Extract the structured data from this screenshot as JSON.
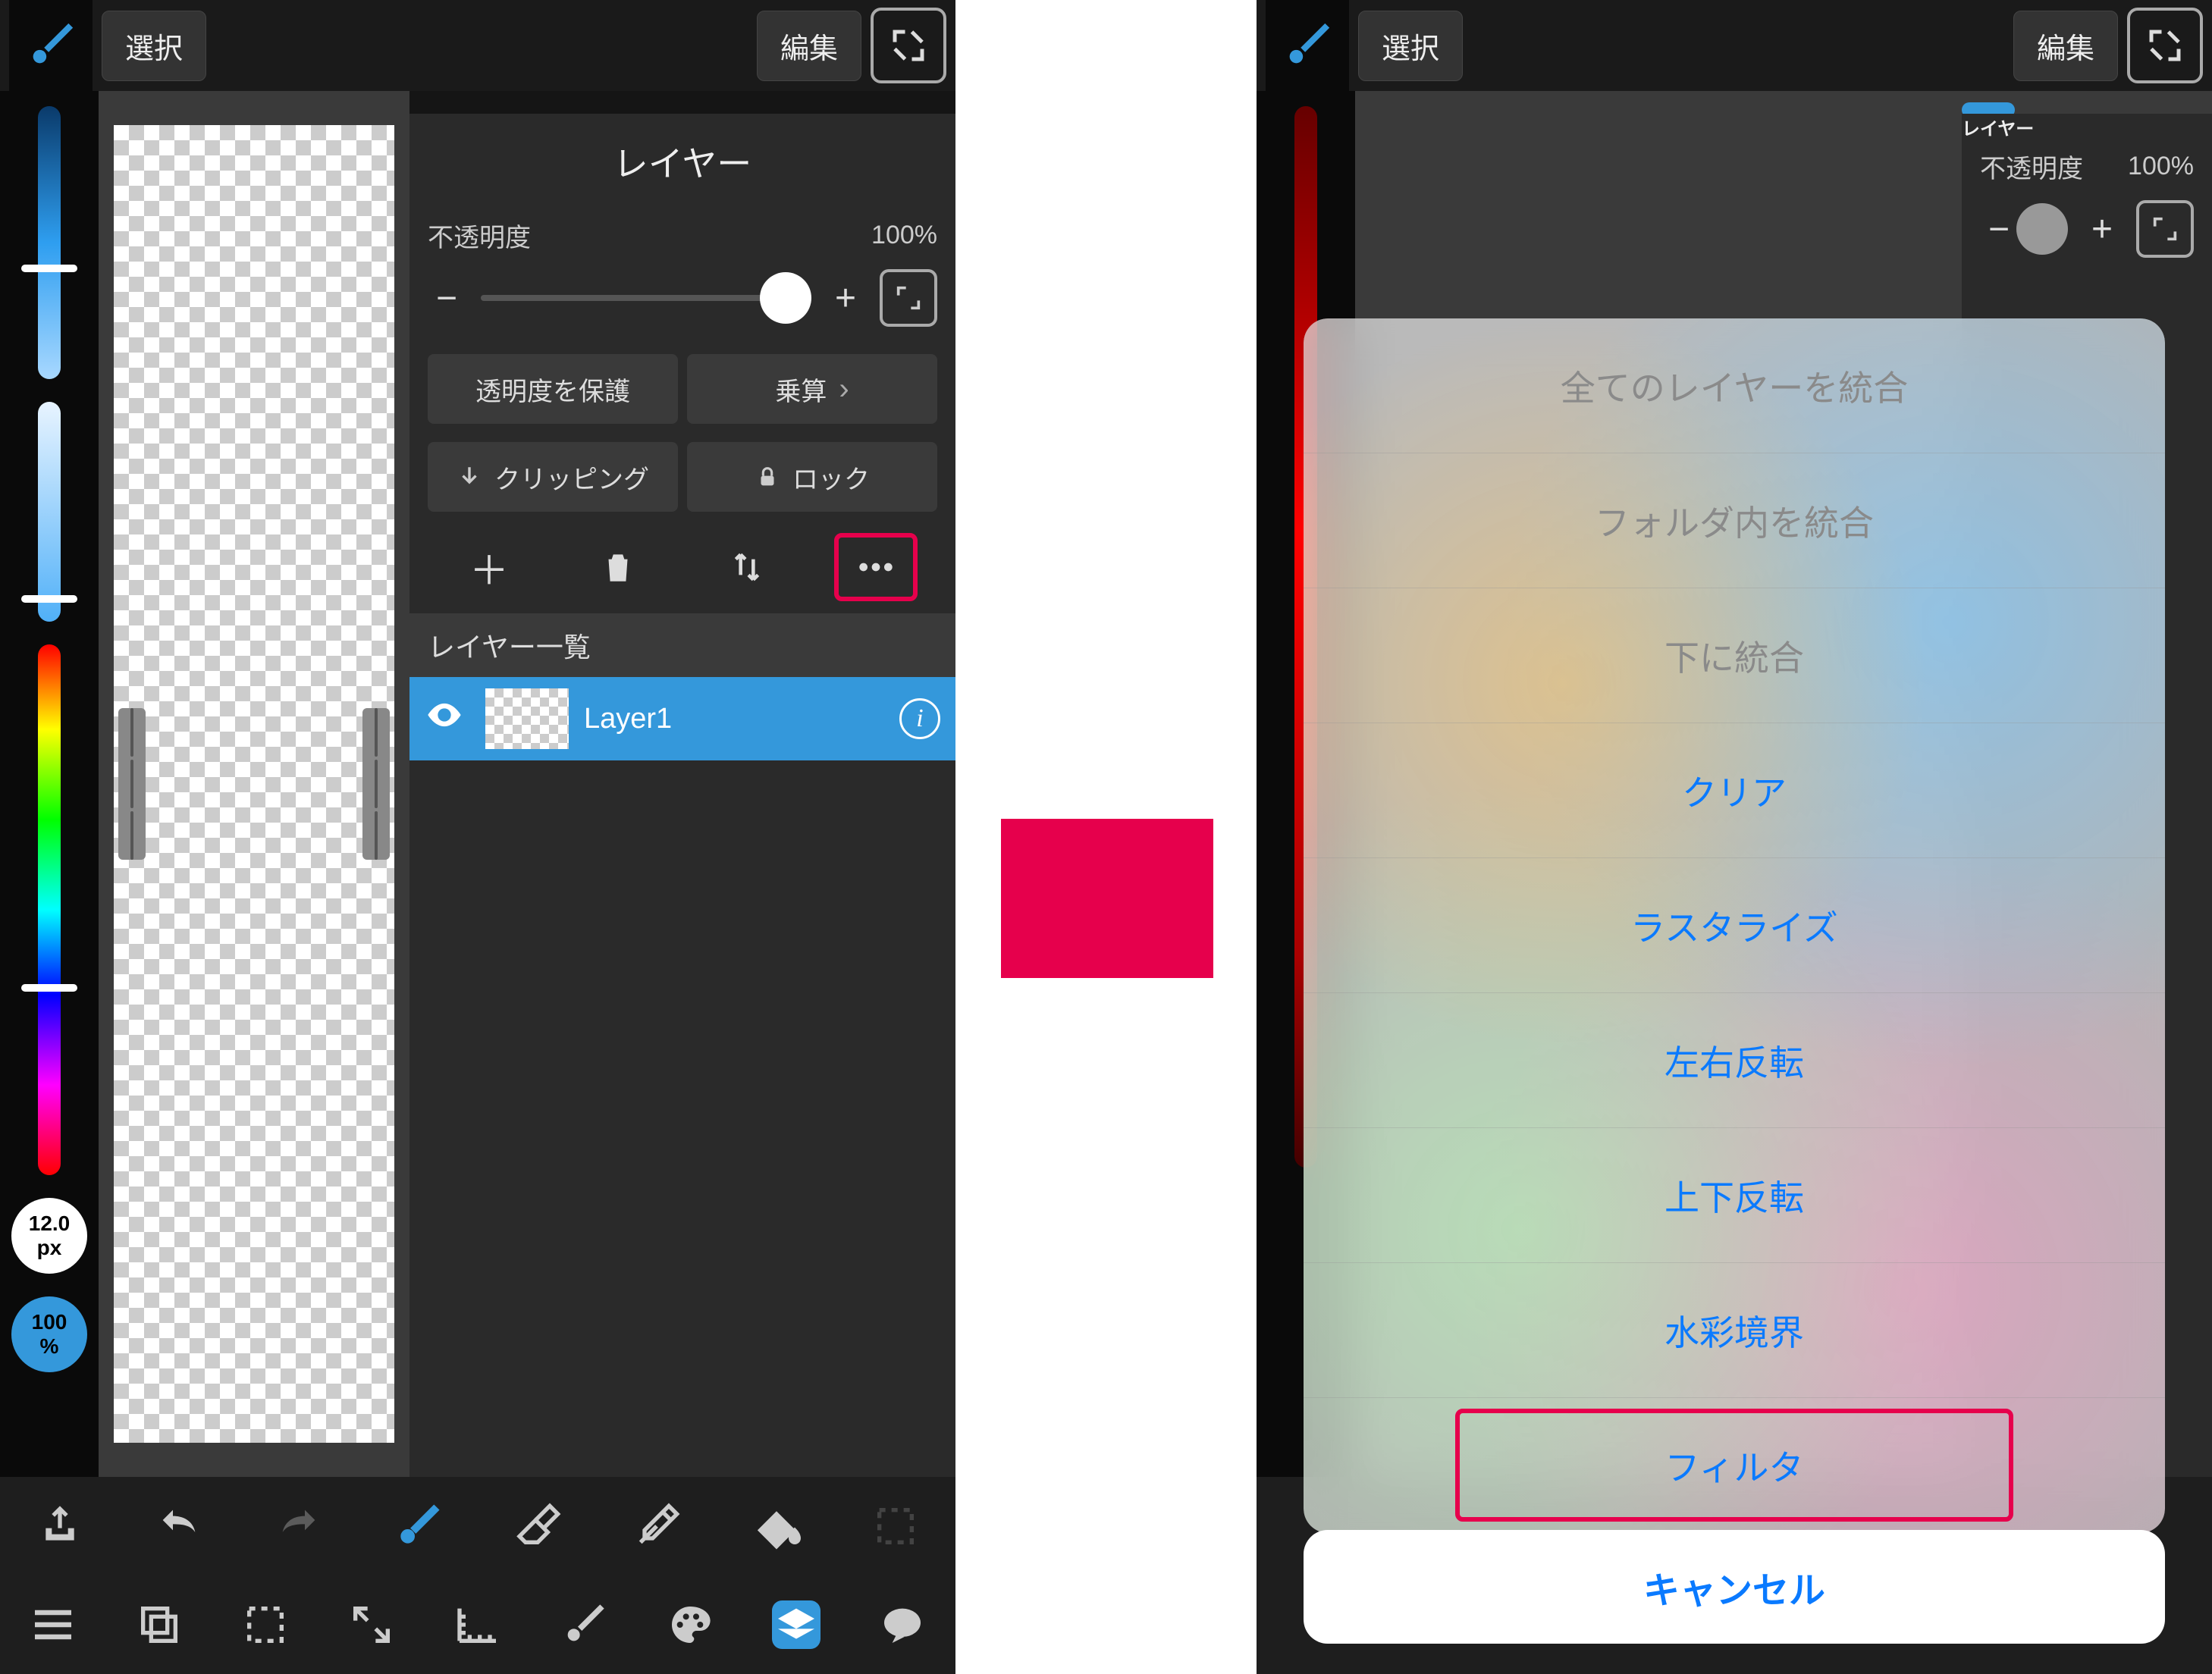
{
  "left": {
    "topbar": {
      "select": "選択",
      "edit": "編集"
    },
    "sliders": {
      "size_value": "12.0",
      "size_unit": "px",
      "opacity_value": "100",
      "opacity_unit": "%"
    },
    "panel": {
      "title": "レイヤー",
      "opacity_label": "不透明度",
      "opacity_value": "100%",
      "minus": "−",
      "plus": "+",
      "protect_alpha": "透明度を保護",
      "blend_mode": "乗算",
      "clipping": "クリッピング",
      "lock": "ロック",
      "list_header": "レイヤー一覧",
      "layer_name": "Layer1"
    }
  },
  "right": {
    "topbar": {
      "select": "選択",
      "edit": "編集"
    },
    "panel": {
      "title": "レイヤー",
      "opacity_label": "不透明度",
      "opacity_value": "100%",
      "minus": "−",
      "plus": "+"
    },
    "actions": {
      "merge_all": "全てのレイヤーを統合",
      "merge_folder": "フォルダ内を統合",
      "merge_down": "下に統合",
      "clear": "クリア",
      "rasterize": "ラスタライズ",
      "flip_h": "左右反転",
      "flip_v": "上下反転",
      "watercolor_edge": "水彩境界",
      "filter": "フィルタ",
      "cancel": "キャンセル"
    }
  },
  "colors": {
    "highlight": "#e6004c",
    "accent": "#3498db",
    "ios_blue": "#0a7aff"
  }
}
